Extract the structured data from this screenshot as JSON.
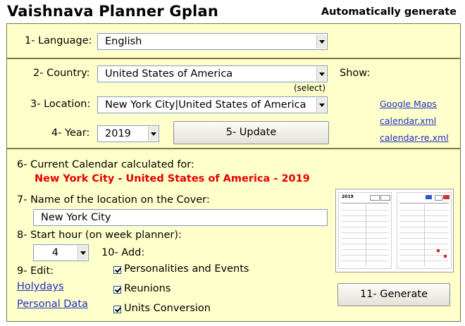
{
  "header": {
    "title": "Vaishnava Planner Gplan",
    "auto": "Automatically generate"
  },
  "language": {
    "label": "1- Language:",
    "value": "English"
  },
  "country": {
    "label": "2- Country:",
    "value": "United States of America",
    "hint": "(select)"
  },
  "location": {
    "label": "3- Location:",
    "value": "New York City|United States of America"
  },
  "year": {
    "label": "4- Year:",
    "value": "2019"
  },
  "update_button": "5- Update",
  "show": {
    "label": "Show:",
    "links": [
      "Google Maps",
      "calendar.xml",
      "calendar-re.xml"
    ]
  },
  "current": {
    "label": "6- Current Calendar calculated for:",
    "value": "New York City - United States of America - 2019"
  },
  "cover_name": {
    "label": "7- Name of the location on the Cover:",
    "value": "New York City"
  },
  "start_hour": {
    "label": "8- Start hour (on week planner):",
    "value": "4"
  },
  "add": {
    "label": "10- Add:",
    "options": [
      "Personalities and Events",
      "Reunions",
      "Units Conversion"
    ],
    "checked": [
      true,
      true,
      true
    ]
  },
  "edit": {
    "label": "9- Edit:",
    "links": [
      "Holydays",
      "Personal Data"
    ]
  },
  "generate_button": "11- Generate",
  "preview": {
    "year_text": "2019"
  },
  "colors": {
    "panel_bg": "#ffffcc",
    "highlight_red": "#e60000",
    "link_blue": "#1f2fbf"
  }
}
